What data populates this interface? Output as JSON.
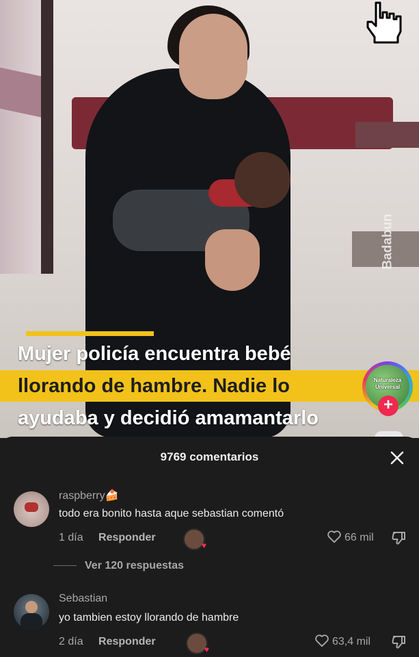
{
  "video": {
    "watermark": "Badabun",
    "caption_lines": [
      "Mujer policía encuentra bebé",
      "llorando de hambre. Nadie lo",
      "ayudaba y decidió amamantarlo"
    ],
    "channel_avatar_text": [
      "Naturaleza",
      "Universal"
    ],
    "follow_plus": "+"
  },
  "comments_panel": {
    "title": "9769 comentarios",
    "close_icon": "close-icon",
    "view_replies": "Ver 120 respuestas",
    "comments": [
      {
        "username": "raspberry🍰",
        "text": "todo era bonito hasta aque sebastian comentó",
        "age": "1 día",
        "reply_label": "Responder",
        "likes": "66 mil"
      },
      {
        "username": "Sebastian",
        "text": "yo tambien estoy llorando de hambre",
        "age": "2 día",
        "reply_label": "Responder",
        "likes": "63,4 mil"
      }
    ]
  },
  "colors": {
    "caption_highlight": "#f2c21a",
    "panel_bg": "#1c1c1c",
    "follow_red": "#ef2950"
  },
  "icons": [
    "hand-cursor-icon",
    "close-icon",
    "heart-icon",
    "dislike-icon"
  ]
}
